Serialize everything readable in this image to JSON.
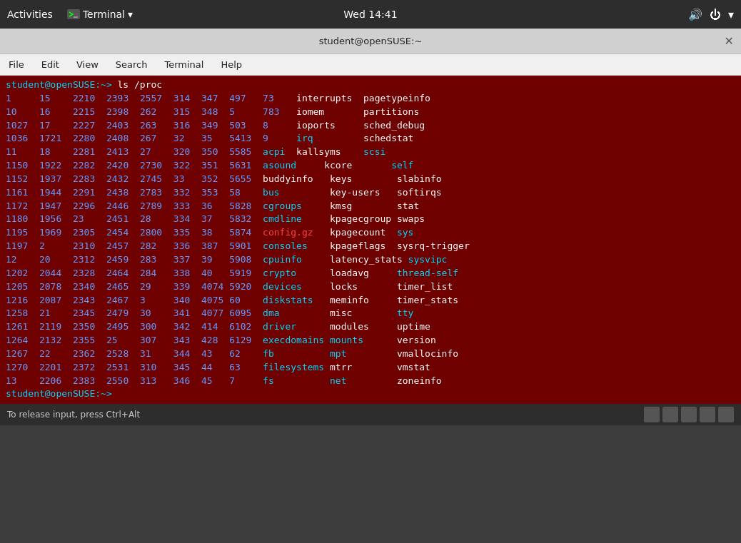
{
  "systembar": {
    "activities": "Activities",
    "terminal_label": "Terminal",
    "time": "Wed 14:41"
  },
  "titlebar": {
    "title": "student@openSUSE:~",
    "close": "✕"
  },
  "menubar": {
    "items": [
      "File",
      "Edit",
      "View",
      "Search",
      "Terminal",
      "Help"
    ]
  },
  "terminal": {
    "prompt": "student@openSUSE:~>",
    "command": " ls /proc",
    "output_rows": [
      [
        "1",
        "15",
        "2210",
        "2393",
        "2557",
        "314",
        "347",
        "497",
        "73",
        "",
        "interrupts",
        "pagetypeinfo"
      ],
      [
        "10",
        "16",
        "2215",
        "2398",
        "262",
        "315",
        "348",
        "5",
        "783",
        "",
        "iomem",
        "partitions"
      ],
      [
        "1027",
        "17",
        "2227",
        "2403",
        "263",
        "316",
        "349",
        "503",
        "8",
        "",
        "ioports",
        "sched_debug"
      ],
      [
        "1036",
        "1721",
        "2280",
        "2408",
        "267",
        "32",
        "35",
        "5413",
        "9",
        "",
        "irq",
        "schedstat"
      ],
      [
        "11",
        "18",
        "2281",
        "2413",
        "27",
        "320",
        "350",
        "5585",
        "acpi",
        "",
        "kallsyms",
        "scsi"
      ],
      [
        "1150",
        "1922",
        "2282",
        "2420",
        "2730",
        "322",
        "351",
        "5631",
        "asound",
        "",
        "kcore",
        "self"
      ],
      [
        "1152",
        "1937",
        "2283",
        "2432",
        "2745",
        "33",
        "352",
        "5655",
        "buddyinfo",
        "",
        "keys",
        "slabinfo"
      ],
      [
        "1161",
        "1944",
        "2291",
        "2438",
        "2783",
        "332",
        "353",
        "58",
        "bus",
        "",
        "key-users",
        "softirqs"
      ],
      [
        "1172",
        "1947",
        "2296",
        "2446",
        "2789",
        "333",
        "36",
        "5828",
        "cgroups",
        "",
        "kmsg",
        "stat"
      ],
      [
        "1180",
        "1956",
        "23",
        "2451",
        "28",
        "334",
        "37",
        "5832",
        "cmdline",
        "",
        "kpagecgroup",
        "swaps"
      ],
      [
        "1195",
        "1969",
        "2305",
        "2454",
        "2800",
        "335",
        "38",
        "5874",
        "config.gz",
        "",
        "kpagecount",
        "sys"
      ],
      [
        "1197",
        "2",
        "2310",
        "2457",
        "282",
        "336",
        "387",
        "5901",
        "consoles",
        "",
        "kpageflags",
        "sysrq-trigger"
      ],
      [
        "12",
        "20",
        "2312",
        "2459",
        "283",
        "337",
        "39",
        "5908",
        "cpuinfo",
        "",
        "latency_stats",
        "sysvipc"
      ],
      [
        "1202",
        "2044",
        "2328",
        "2464",
        "284",
        "338",
        "40",
        "5919",
        "crypto",
        "",
        "loadavg",
        "thread-self"
      ],
      [
        "1205",
        "2078",
        "2340",
        "2465",
        "29",
        "339",
        "4074",
        "5920",
        "devices",
        "",
        "locks",
        "timer_list"
      ],
      [
        "1216",
        "2087",
        "2343",
        "2467",
        "3",
        "340",
        "4075",
        "60",
        "diskstats",
        "",
        "meminfo",
        "timer_stats"
      ],
      [
        "1258",
        "21",
        "2345",
        "2479",
        "30",
        "341",
        "4077",
        "6095",
        "dma",
        "",
        "misc",
        "tty"
      ],
      [
        "1261",
        "2119",
        "2350",
        "2495",
        "300",
        "342",
        "414",
        "6102",
        "driver",
        "",
        "modules",
        "uptime"
      ],
      [
        "1264",
        "2132",
        "2355",
        "25",
        "307",
        "343",
        "428",
        "6129",
        "execdomains",
        "",
        "mounts",
        "version"
      ],
      [
        "1267",
        "22",
        "2362",
        "2528",
        "31",
        "344",
        "43",
        "62",
        "fb",
        "",
        "mpt",
        "vmallocinfo"
      ],
      [
        "1270",
        "2201",
        "2372",
        "2531",
        "310",
        "345",
        "44",
        "63",
        "filesystems",
        "",
        "mtrr",
        "vmstat"
      ],
      [
        "13",
        "2206",
        "2383",
        "2550",
        "313",
        "346",
        "45",
        "7",
        "fs",
        "",
        "net",
        "zoneinfo"
      ]
    ],
    "final_prompt": "student@openSUSE:~>",
    "colored_entries": {
      "irq": "cyan",
      "scsi": "cyan",
      "self": "cyan",
      "config.gz": "red",
      "bus": "cyan",
      "acpi": "cyan",
      "asound": "cyan",
      "cgroups": "cyan",
      "cmdline": "cyan",
      "consoles": "cyan",
      "cpuinfo": "cyan",
      "crypto": "cyan",
      "devices": "cyan",
      "diskstats": "cyan",
      "dma": "cyan",
      "driver": "cyan",
      "execdomains": "cyan",
      "fb": "cyan",
      "filesystems": "cyan",
      "fs": "cyan",
      "mounts": "cyan",
      "mpt": "cyan",
      "net": "cyan",
      "tty": "cyan",
      "sys": "cyan",
      "sysvipc": "cyan",
      "thread-self": "cyan"
    }
  },
  "statusbar": {
    "hint": "To release input, press Ctrl+Alt"
  }
}
